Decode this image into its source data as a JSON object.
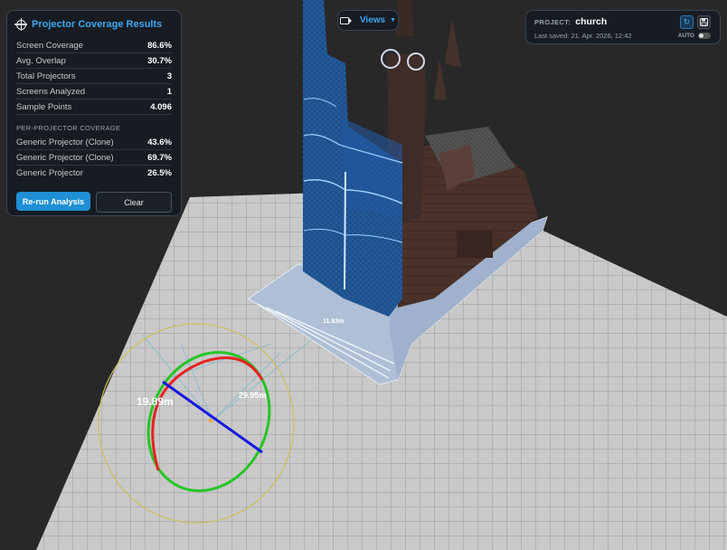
{
  "results": {
    "title": "Projector Coverage Results",
    "stats": [
      {
        "label": "Screen Coverage",
        "value": "86.6%"
      },
      {
        "label": "Avg. Overlap",
        "value": "30.7%"
      },
      {
        "label": "Total Projectors",
        "value": "3"
      },
      {
        "label": "Screens Analyzed",
        "value": "1"
      },
      {
        "label": "Sample Points",
        "value": "4.096"
      }
    ],
    "per_projector_title": "PER-PROJECTOR COVERAGE",
    "projectors": [
      {
        "label": "Generic Projector (Clone)",
        "value": "43.6%"
      },
      {
        "label": "Generic Projector (Clone)",
        "value": "69.7%"
      },
      {
        "label": "Generic Projector",
        "value": "26.5%"
      }
    ],
    "rerun_label": "Re-run Analysis",
    "clear_label": "Clear"
  },
  "views": {
    "label": "Views"
  },
  "project": {
    "label": "PROJECT:",
    "name": "church",
    "saved": "Last saved: 21. Apr. 2026, 12:42",
    "auto_label": "AUTO"
  },
  "viewport": {
    "measure_1": "19.89m",
    "measure_2": "29.95m",
    "measure_3": "11.93m"
  },
  "colors": {
    "accent": "#3ea6f0",
    "primary_button": "#1f8fd6",
    "projection_blue": "#1d4f8a"
  }
}
